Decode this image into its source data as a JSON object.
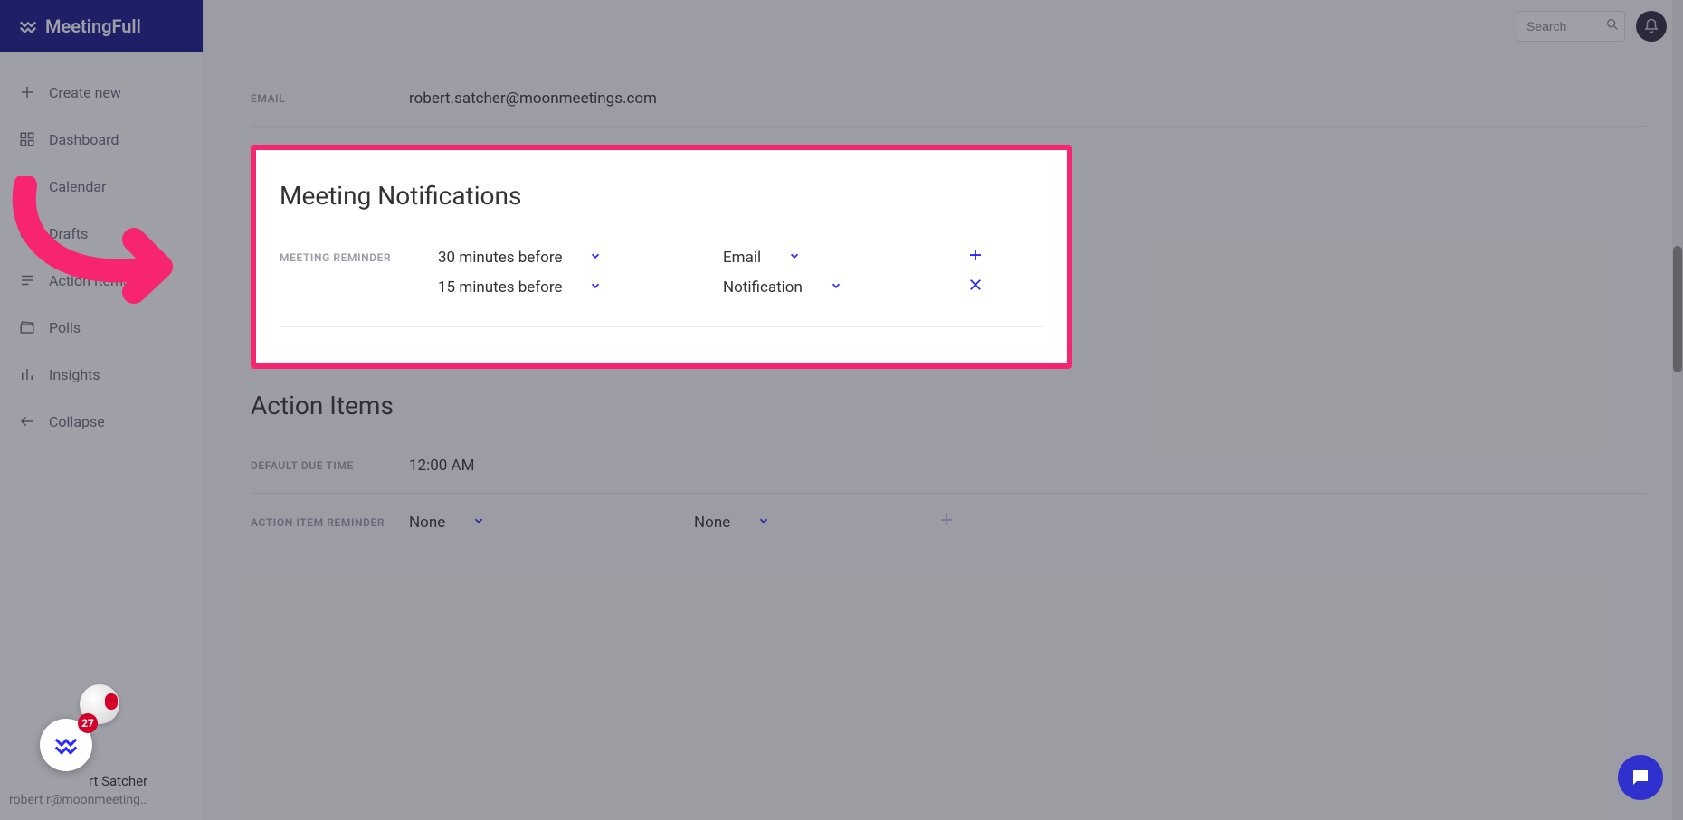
{
  "brand": {
    "name": "MeetingFull"
  },
  "topbar": {
    "search_placeholder": "Search"
  },
  "sidebar": {
    "create_label": "Create new",
    "items": [
      {
        "label": "Dashboard",
        "icon": "grid-icon"
      },
      {
        "label": "Calendar",
        "icon": "calendar-icon"
      },
      {
        "label": "Drafts",
        "icon": "clock-icon"
      },
      {
        "label": "Action Items",
        "icon": "list-icon"
      },
      {
        "label": "Polls",
        "icon": "clapper-icon"
      },
      {
        "label": "Insights",
        "icon": "bars-icon"
      },
      {
        "label": "Collapse",
        "icon": "arrow-left-icon"
      }
    ],
    "user": {
      "name_suffix": "rt Satcher",
      "email_display": "robert            r@moonmeeting…"
    }
  },
  "email_section": {
    "label": "EMAIL",
    "value": "robert.satcher@moonmeetings.com"
  },
  "notifications": {
    "title": "Meeting Notifications",
    "reminder_label": "MEETING REMINDER",
    "rows": [
      {
        "time": "30 minutes before",
        "method": "Email",
        "action": "add"
      },
      {
        "time": "15 minutes before",
        "method": "Notification",
        "action": "remove"
      }
    ]
  },
  "action_items": {
    "title": "Action Items",
    "due_label": "DEFAULT DUE TIME",
    "due_value": "12:00 AM",
    "reminder_label": "ACTION ITEM REMINDER",
    "rows": [
      {
        "time": "None",
        "method": "None",
        "action": "add_disabled"
      }
    ]
  },
  "badge": {
    "count": "27"
  },
  "colors": {
    "brand_bg": "#17178c",
    "highlight_border": "#f7256f",
    "accent": "#2b2bff"
  }
}
